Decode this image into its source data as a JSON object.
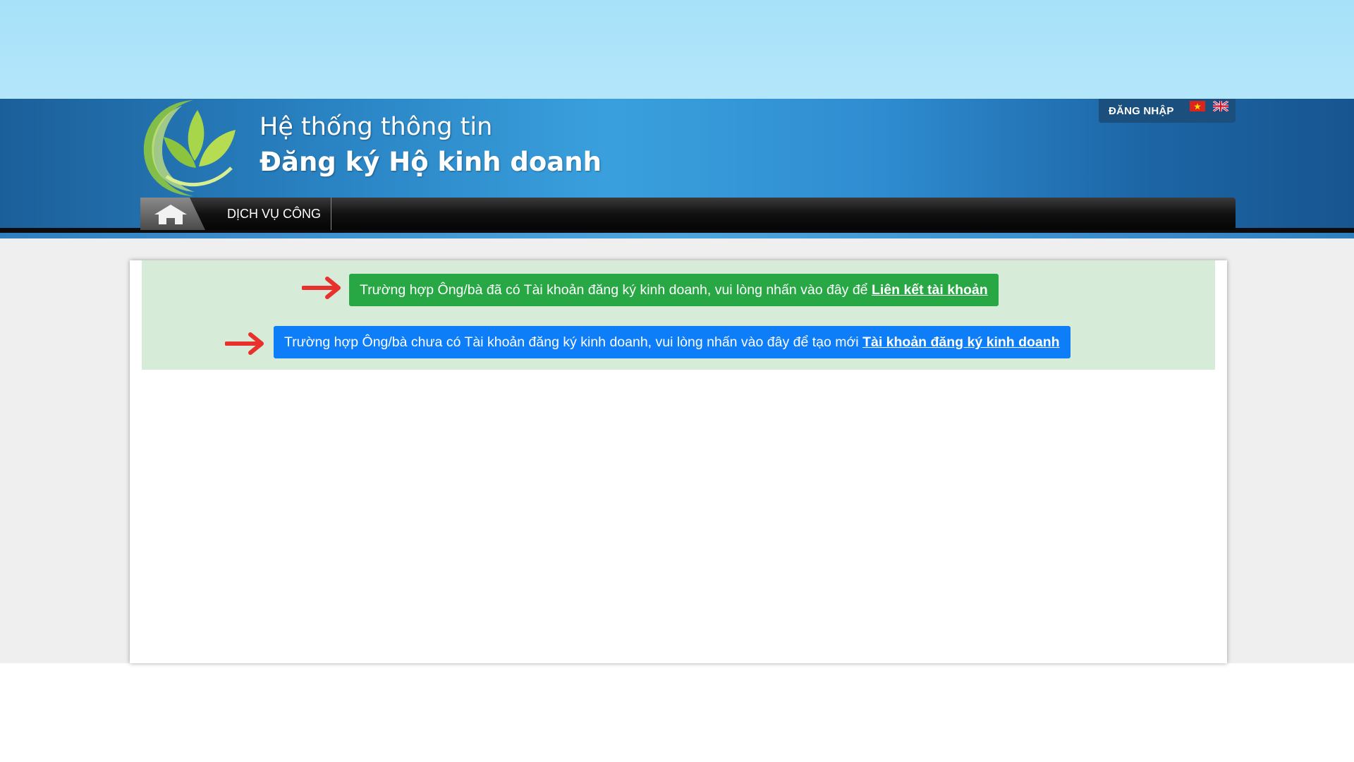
{
  "header": {
    "title_line1": "Hệ thống thông tin",
    "title_line2": "Đăng ký Hộ kinh doanh",
    "login_label": "ĐĂNG NHẬP",
    "flags": [
      "vietnam-flag-icon",
      "uk-flag-icon"
    ]
  },
  "nav": {
    "home_icon": "home-icon",
    "items": [
      {
        "label": "DỊCH VỤ CÔNG"
      }
    ]
  },
  "notices": {
    "link_account": {
      "text": "Trường hợp Ông/bà đã có Tài khoản đăng ký kinh doanh, vui lòng nhấn vào đây để ",
      "link_label": "Liên kết tài khoản",
      "color": "#28a745"
    },
    "create_account": {
      "text": "Trường hợp Ông/bà chưa có Tài khoản đăng ký kinh doanh, vui lòng nhấn vào đây để tạo mới ",
      "link_label": "Tài khoản đăng ký kinh doanh",
      "color": "#0d7df8"
    },
    "arrow_icon": "red-arrow-right-icon",
    "background": "#d6ecd9"
  },
  "colors": {
    "top_band": "#a6e1f9",
    "header_blue": "#2a84c4",
    "navbar": "#111111",
    "arrow_red": "#e8302d"
  }
}
